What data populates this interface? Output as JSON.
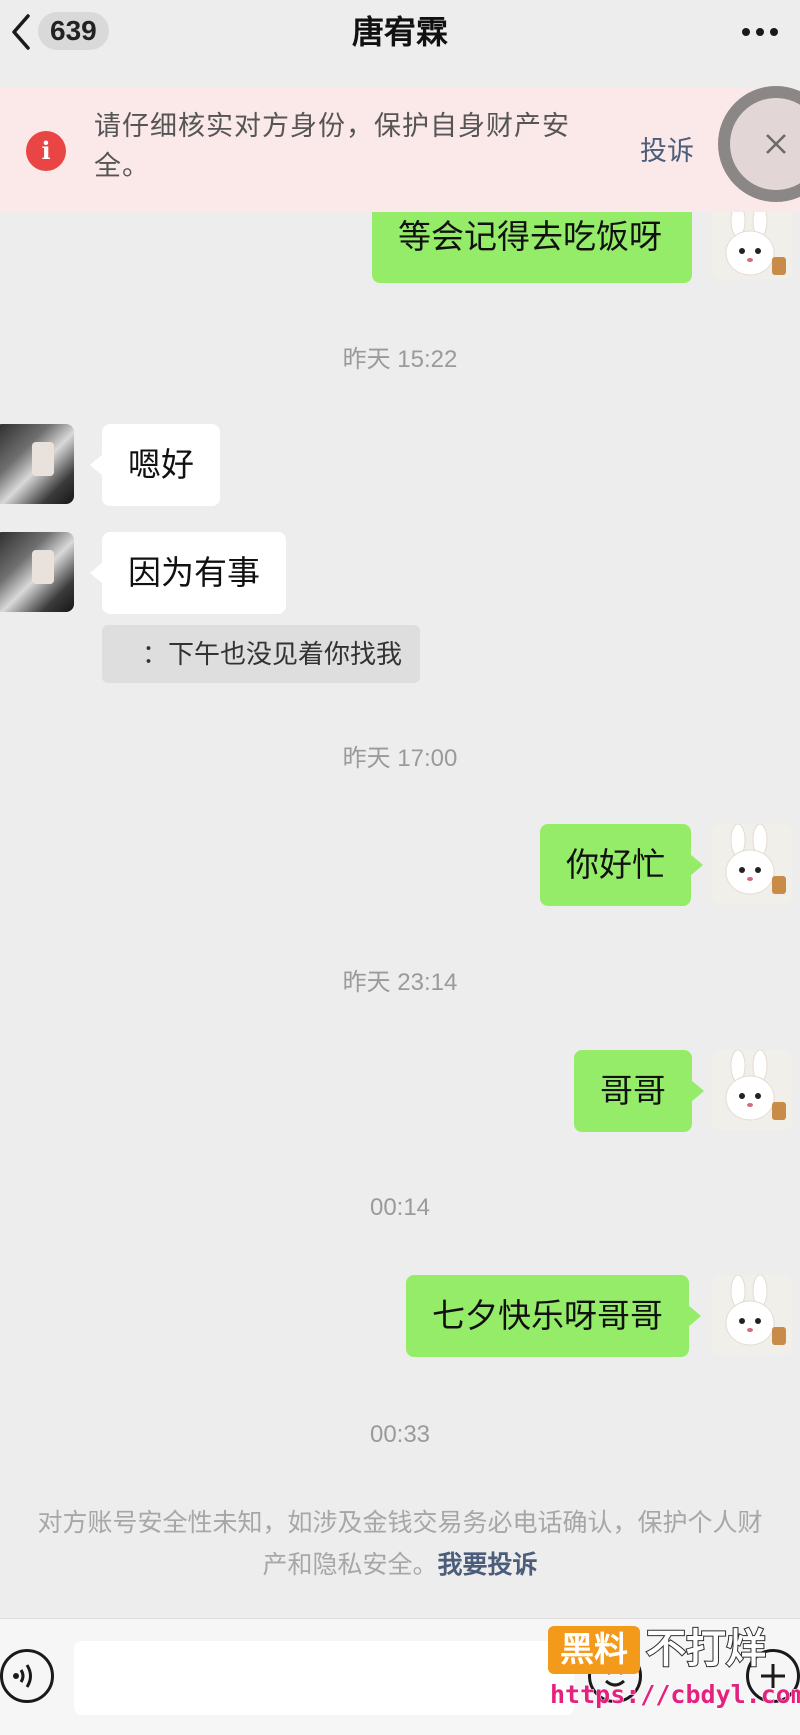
{
  "header": {
    "unread_count": "639",
    "title": "唐宥霖",
    "more_icon": "more-icon",
    "back_icon": "chevron-left-icon"
  },
  "warning": {
    "text": "请仔细核实对方身份，保护自身财产安全。",
    "report_label": "投诉",
    "icon": "info-icon",
    "close_icon": "close-icon"
  },
  "messages": [
    {
      "side": "out",
      "text": "等会记得去吃饭呀"
    },
    {
      "type": "time",
      "text": "昨天 15:22"
    },
    {
      "side": "in",
      "text": "嗯好"
    },
    {
      "side": "in",
      "text": "因为有事"
    },
    {
      "type": "quote",
      "text": "：下午也没见着你找我"
    },
    {
      "type": "time",
      "text": "昨天 17:00"
    },
    {
      "side": "out",
      "text": "你好忙"
    },
    {
      "type": "time",
      "text": "昨天 23:14"
    },
    {
      "side": "out",
      "text": "哥哥"
    },
    {
      "type": "time",
      "text": "00:14"
    },
    {
      "side": "out",
      "text": "七夕快乐呀哥哥"
    },
    {
      "type": "time",
      "text": "00:33"
    }
  ],
  "system_notice": {
    "text": "对方账号安全性未知，如涉及金钱交易务必电话确认，保护个人财产和隐私安全。",
    "link": "我要投诉"
  },
  "input_bar": {
    "voice_icon": "voice-icon",
    "emoji_icon": "emoji-icon",
    "plus_icon": "plus-icon",
    "value": ""
  },
  "watermark": {
    "badge": "黑料",
    "title": "不打烊",
    "url": "https://cbdyl.com"
  },
  "colors": {
    "background": "#ededed",
    "outgoing_bubble": "#95ec69",
    "incoming_bubble": "#ffffff",
    "warning_bg": "#fbe8e8",
    "warning_icon": "#e94545",
    "link": "#4b5d7a"
  }
}
